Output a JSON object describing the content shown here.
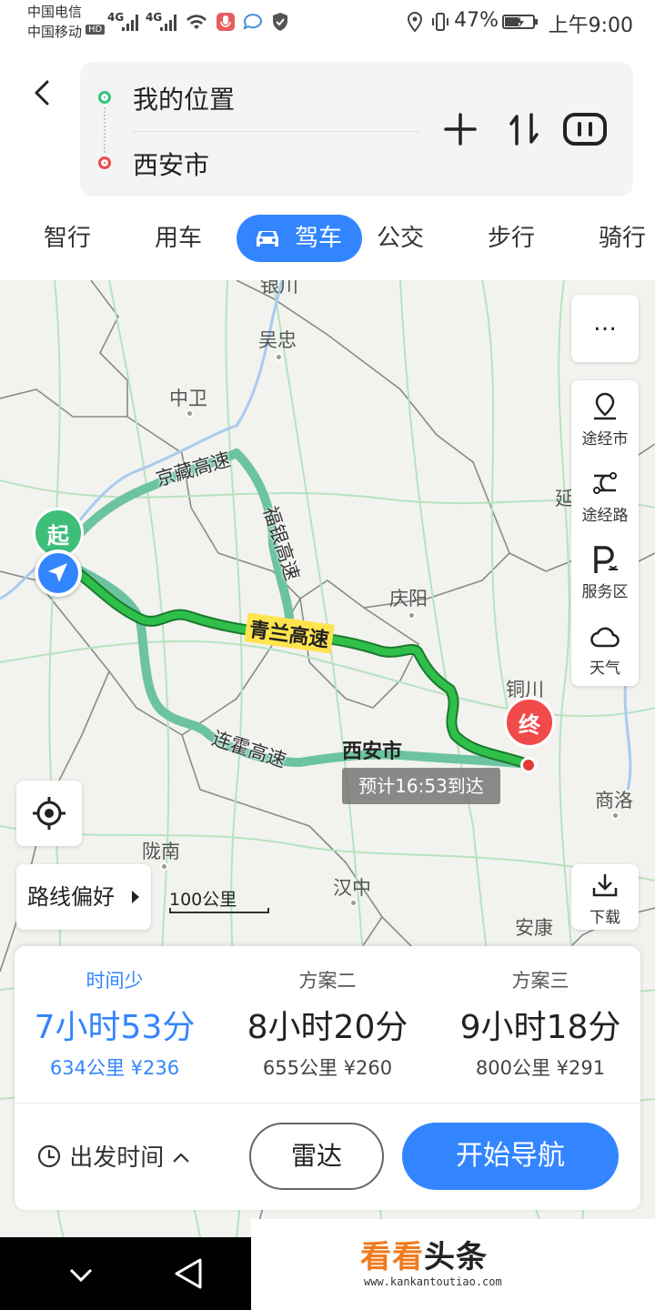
{
  "status_bar": {
    "carrier1": "中国电信",
    "carrier2": "中国移动",
    "hd": "HD",
    "net1": "4G",
    "net2": "4G",
    "battery": "47%",
    "time": "上午9:00"
  },
  "search": {
    "from": "我的位置",
    "to": "西安市"
  },
  "tabs": [
    {
      "label": "智行"
    },
    {
      "label": "用车"
    },
    {
      "label": "驾车"
    },
    {
      "label": "公交"
    },
    {
      "label": "步行"
    },
    {
      "label": "骑行"
    }
  ],
  "map": {
    "cities": {
      "yinchuan": "银川",
      "wuzhong": "吴忠",
      "zhongwei": "中卫",
      "qingyang": "庆阳",
      "tongchuan": "铜川",
      "yan": "延",
      "xian": "西安市",
      "shangluo": "商洛",
      "longnan": "陇南",
      "hanzhong": "汉中",
      "ankang": "安康"
    },
    "highways": {
      "jingzang": "京藏高速",
      "fuyin": "福银高速",
      "qinglan": "青兰高速",
      "lianhuo": "连霍高速"
    },
    "eta": "预计16:53到达",
    "start_marker": "起",
    "end_marker": "终",
    "scale": "100公里",
    "route_pref": "路线偏好",
    "side": {
      "more": "…",
      "via_city": "途经市",
      "via_road": "途经路",
      "service": "服务区",
      "weather": "天气",
      "download": "下载"
    }
  },
  "plans": [
    {
      "name": "时间少",
      "time": "7小时53分",
      "info": "634公里 ¥236"
    },
    {
      "name": "方案二",
      "time": "8小时20分",
      "info": "655公里 ¥260"
    },
    {
      "name": "方案三",
      "time": "9小时18分",
      "info": "800公里 ¥291"
    }
  ],
  "actions": {
    "depart": "出发时间",
    "radar": "雷达",
    "navigate": "开始导航"
  },
  "watermark": {
    "brand1": "看看",
    "brand2": "头条",
    "url": "www.kankantoutiao.com"
  },
  "colors": {
    "accent": "#3385ff",
    "route_main": "#1fa83a",
    "route_alt": "#6cc3a0",
    "start": "#3dbf7a",
    "end": "#f14a4a"
  }
}
